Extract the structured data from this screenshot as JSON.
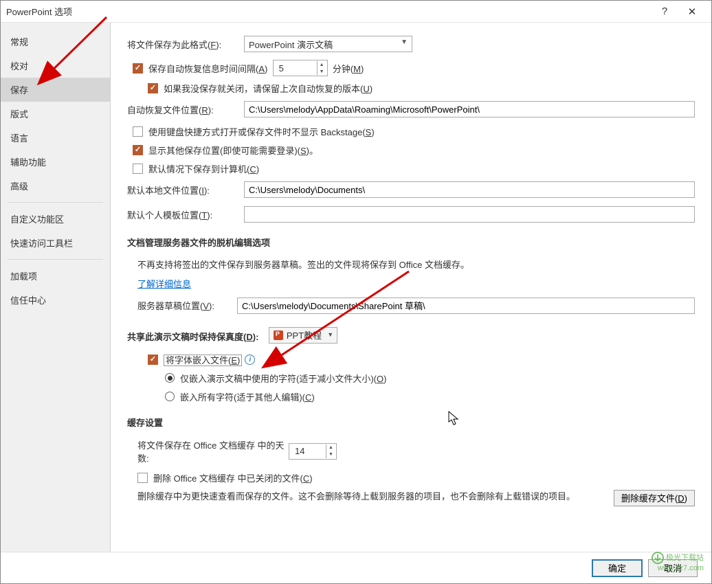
{
  "window": {
    "title": "PowerPoint 选项"
  },
  "sidebar": {
    "items": [
      {
        "label": "常规"
      },
      {
        "label": "校对"
      },
      {
        "label": "保存",
        "active": true
      },
      {
        "label": "版式"
      },
      {
        "label": "语言"
      },
      {
        "label": "辅助功能"
      },
      {
        "label": "高级"
      },
      {
        "label": "自定义功能区"
      },
      {
        "label": "快速访问工具栏"
      },
      {
        "label": "加载项"
      },
      {
        "label": "信任中心"
      }
    ]
  },
  "save": {
    "format_label_prefix": "将文件保存为此格式(",
    "format_hot": "F",
    "format_label_suffix": "):",
    "format_value": "PowerPoint 演示文稿",
    "autorecover_prefix": "保存自动恢复信息时间间隔(",
    "autorecover_hot": "A",
    "autorecover_suffix": ")",
    "autorecover_value": "5",
    "minutes_prefix": "分钟(",
    "minutes_hot": "M",
    "minutes_suffix": ")",
    "keep_last_prefix": "如果我没保存就关闭，请保留上次自动恢复的版本(",
    "keep_last_hot": "U",
    "keep_last_suffix": ")",
    "autorecover_loc_prefix": "自动恢复文件位置(",
    "autorecover_loc_hot": "R",
    "autorecover_loc_suffix": "):",
    "autorecover_loc_value": "C:\\Users\\melody\\AppData\\Roaming\\Microsoft\\PowerPoint\\",
    "no_backstage_prefix": "使用键盘快捷方式打开或保存文件时不显示 Backstage(",
    "no_backstage_hot": "S",
    "no_backstage_suffix": ")",
    "show_other_prefix": "显示其他保存位置(即使可能需要登录)(",
    "show_other_hot": "S",
    "show_other_suffix": ")。",
    "default_pc_prefix": "默认情况下保存到计算机(",
    "default_pc_hot": "C",
    "default_pc_suffix": ")",
    "default_loc_prefix": "默认本地文件位置(",
    "default_loc_hot": "I",
    "default_loc_suffix": "):",
    "default_loc_value": "C:\\Users\\melody\\Documents\\",
    "default_tpl_prefix": "默认个人模板位置(",
    "default_tpl_hot": "T",
    "default_tpl_suffix": "):",
    "default_tpl_value": ""
  },
  "docmgmt": {
    "title": "文档管理服务器文件的脱机编辑选项",
    "note": "不再支持将签出的文件保存到服务器草稿。签出的文件现将保存到 Office 文档缓存。",
    "learn_more": "了解详细信息",
    "server_draft_prefix": "服务器草稿位置(",
    "server_draft_hot": "V",
    "server_draft_suffix": "):",
    "server_draft_value": "C:\\Users\\melody\\Documents\\SharePoint 草稿\\"
  },
  "fidelity": {
    "title_prefix": "共享此演示文稿时保持保真度(",
    "title_hot": "D",
    "title_suffix": "):",
    "doc_name": "PPT教程",
    "embed_prefix": "将字体嵌入文件(",
    "embed_hot": "E",
    "embed_suffix": ")",
    "embed_used_prefix": "仅嵌入演示文稿中使用的字符(适于减小文件大小)(",
    "embed_used_hot": "O",
    "embed_used_suffix": ")",
    "embed_all_prefix": "嵌入所有字符(适于其他人编辑)(",
    "embed_all_hot": "C",
    "embed_all_suffix": ")"
  },
  "cache": {
    "title": "缓存设置",
    "days_label": "将文件保存在 Office 文档缓存 中的天数:",
    "days_value": "14",
    "del_closed_prefix": "删除 Office 文档缓存 中已关闭的文件(",
    "del_closed_hot": "C",
    "del_closed_suffix": ")",
    "del_note": "删除缓存中为更快速查看而保存的文件。这不会删除等待上载到服务器的项目，也不会删除有上载错误的项目。",
    "del_btn_prefix": "删除缓存文件(",
    "del_btn_hot": "D",
    "del_btn_suffix": ")"
  },
  "footer": {
    "ok": "确定",
    "cancel": "取消"
  },
  "watermark": {
    "line1": "极光下载站",
    "line2": "www.xz7.com"
  }
}
